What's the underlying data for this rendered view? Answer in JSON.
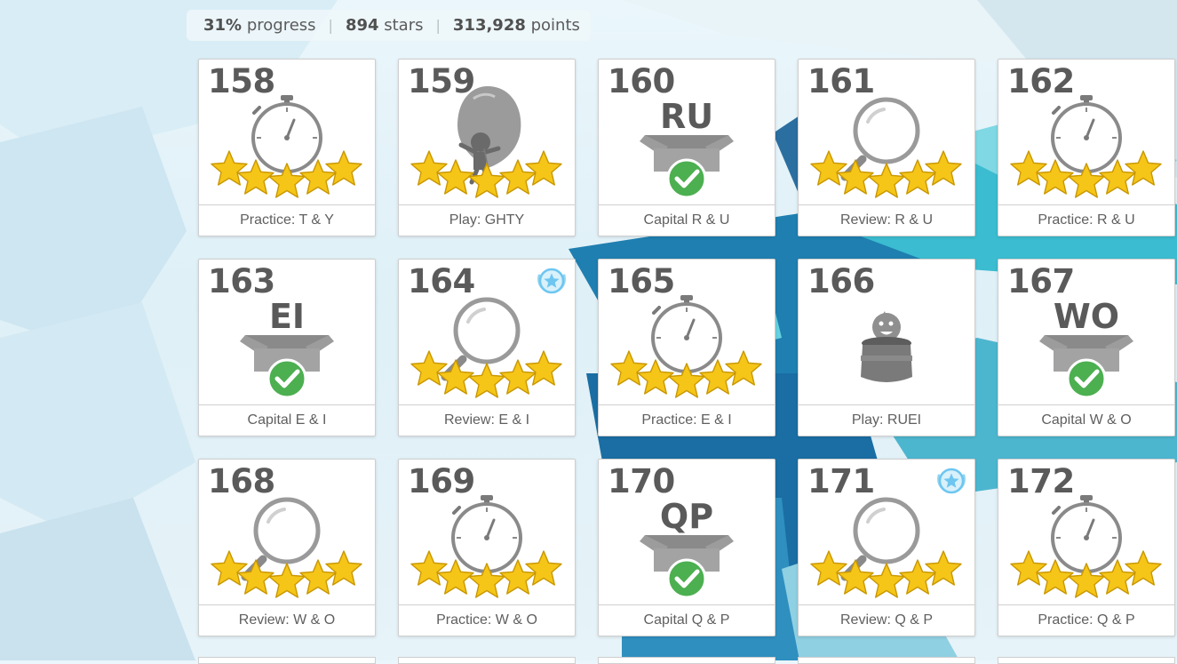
{
  "stats": {
    "progress_value": "31%",
    "progress_label": "progress",
    "stars_value": "894",
    "stars_label": "stars",
    "points_value": "313,928",
    "points_label": "points"
  },
  "colors": {
    "star": "#f5c518",
    "check": "#4caf50",
    "icon_gray": "#8a8a8a",
    "badge": "#6ec6f0",
    "text": "#5a5a5a"
  },
  "lessons": [
    {
      "number": "158",
      "caption": "Practice: T & Y",
      "icon": "stopwatch-icon",
      "stars": 5
    },
    {
      "number": "159",
      "caption": "Play: GHTY",
      "icon": "balloon-character-icon",
      "stars": 5
    },
    {
      "number": "160",
      "caption": "Capital R & U",
      "icon": "letter-box-icon",
      "letters": "RU",
      "completed": true
    },
    {
      "number": "161",
      "caption": "Review: R & U",
      "icon": "magnifier-icon",
      "stars": 5
    },
    {
      "number": "162",
      "caption": "Practice: R & U",
      "icon": "stopwatch-icon",
      "stars": 5
    },
    {
      "number": "163",
      "caption": "Capital E & I",
      "icon": "letter-box-icon",
      "letters": "EI",
      "completed": true
    },
    {
      "number": "164",
      "caption": "Review: E & I",
      "icon": "magnifier-icon",
      "stars": 5,
      "badge": "star-badge-icon"
    },
    {
      "number": "165",
      "caption": "Practice: E & I",
      "icon": "stopwatch-icon",
      "stars": 5
    },
    {
      "number": "166",
      "caption": "Play: RUEI",
      "icon": "jar-character-icon"
    },
    {
      "number": "167",
      "caption": "Capital W & O",
      "icon": "letter-box-icon",
      "letters": "WO",
      "completed": true
    },
    {
      "number": "168",
      "caption": "Review: W & O",
      "icon": "magnifier-icon",
      "stars": 5
    },
    {
      "number": "169",
      "caption": "Practice: W & O",
      "icon": "stopwatch-icon",
      "stars": 5
    },
    {
      "number": "170",
      "caption": "Capital Q & P",
      "icon": "letter-box-icon",
      "letters": "QP",
      "completed": true
    },
    {
      "number": "171",
      "caption": "Review: Q & P",
      "icon": "magnifier-icon",
      "stars": 5,
      "badge": "star-badge-icon"
    },
    {
      "number": "172",
      "caption": "Practice: Q & P",
      "icon": "stopwatch-icon",
      "stars": 5
    }
  ]
}
